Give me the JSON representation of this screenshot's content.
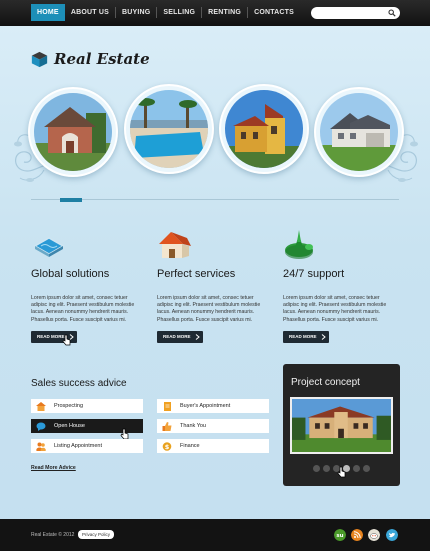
{
  "nav": {
    "items": [
      "HOME",
      "ABOUT US",
      "BUYING",
      "SELLING",
      "RENTING",
      "CONTACTS"
    ],
    "active": "HOME"
  },
  "search": {
    "placeholder": "",
    "icon": "search-icon"
  },
  "logo": {
    "text": "Real Estate",
    "icon": "cube-icon"
  },
  "slider": {
    "position_fraction": 0.1
  },
  "features": [
    {
      "title": "Global solutions",
      "icon": "pool-icon",
      "text": "Lorem ipsum dolor sit amet, consec tetuer adipisc ing elit. Praesent vestibulum molestie lacus. Aenean nonummy hendrerit mauris. Phasellus porta. Fusce suscipit varius mi.",
      "button": "READ MORE"
    },
    {
      "title": "Perfect services",
      "icon": "house-icon",
      "text": "Lorem ipsum dolor sit amet, consec tetuer adipisc ing elit. Praesent vestibulum molestie lacus. Aenean nonummy hendrerit mauris. Phasellus porta. Fusce suscipit varius mi.",
      "button": "READ MORE"
    },
    {
      "title": "24/7 support",
      "icon": "island-icon",
      "text": "Lorem ipsum dolor sit amet, consec tetuer adipisc ing elit. Praesent vestibulum molestie lacus. Aenean nonummy hendrerit mauris. Phasellus porta. Fusce suscipit varius mi.",
      "button": "READ MORE"
    }
  ],
  "advice": {
    "title": "Sales success advice",
    "items": [
      {
        "label": "Prospecting",
        "icon": "house-icon"
      },
      {
        "label": "Buyer's Appointment",
        "icon": "document-icon"
      },
      {
        "label": "Open House",
        "icon": "chat-icon",
        "selected": true
      },
      {
        "label": "Thank You",
        "icon": "thumbs-up-icon"
      },
      {
        "label": "Listing Appointment",
        "icon": "people-icon"
      },
      {
        "label": "Finance",
        "icon": "dollar-icon"
      }
    ],
    "read_more": "Read More Advice"
  },
  "project": {
    "title": "Project concept",
    "dots": 6,
    "active_dot": 3
  },
  "footer": {
    "copyright": "Real Estate © 2012",
    "privacy": "Privacy Policy",
    "social": [
      "stumbleupon-icon",
      "rss-icon",
      "reddit-icon",
      "twitter-icon"
    ]
  },
  "colors": {
    "accent": "#1d8fb8",
    "dark": "#1f2a33",
    "background": "#c9e3f1"
  }
}
